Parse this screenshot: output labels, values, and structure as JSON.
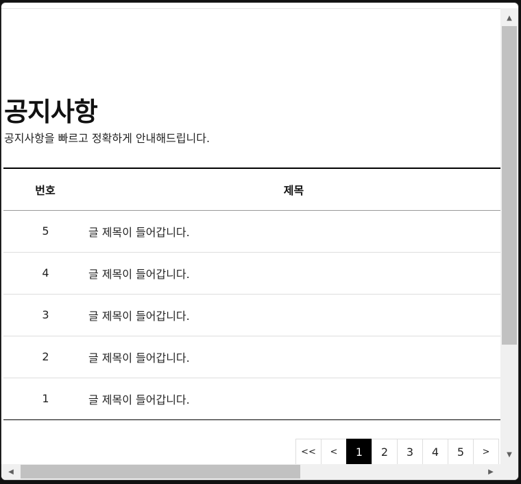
{
  "notice": {
    "title": "공지사항",
    "description": "공지사항을 빠르고 정확하게 안내해드립니다."
  },
  "table": {
    "headers": {
      "number": "번호",
      "title": "제목"
    },
    "rows": [
      {
        "number": "5",
        "title": "글 제목이 들어갑니다."
      },
      {
        "number": "4",
        "title": "글 제목이 들어갑니다."
      },
      {
        "number": "3",
        "title": "글 제목이 들어갑니다."
      },
      {
        "number": "2",
        "title": "글 제목이 들어갑니다."
      },
      {
        "number": "1",
        "title": "글 제목이 들어갑니다."
      }
    ]
  },
  "pagination": {
    "first": "<<",
    "prev": "<",
    "pages": [
      "1",
      "2",
      "3",
      "4",
      "5"
    ],
    "current": "1",
    "next": ">"
  },
  "icons": {
    "scroll_up": "triangle-up",
    "scroll_down": "triangle-down",
    "scroll_left": "triangle-left",
    "scroll_right": "triangle-right"
  }
}
